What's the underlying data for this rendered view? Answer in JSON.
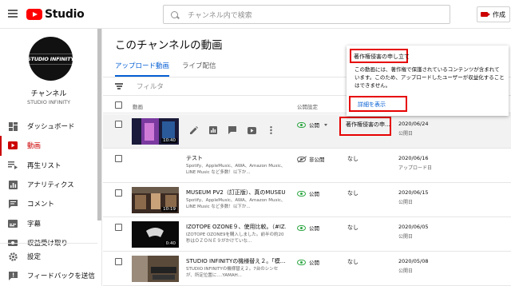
{
  "app": {
    "logo_text": "Studio"
  },
  "search": {
    "placeholder": "チャンネル内で検索"
  },
  "header": {
    "create_label": "作成"
  },
  "channel": {
    "avatar_text": "STUDIO INFINITY",
    "title": "チャンネル",
    "name": "STUDIO INFINITY"
  },
  "sidebar": {
    "items": [
      {
        "label": "ダッシュボード",
        "icon": "dashboard-icon"
      },
      {
        "label": "動画",
        "icon": "video-icon",
        "active": true
      },
      {
        "label": "再生リスト",
        "icon": "playlist-icon"
      },
      {
        "label": "アナリティクス",
        "icon": "analytics-icon"
      },
      {
        "label": "コメント",
        "icon": "comment-icon"
      },
      {
        "label": "字幕",
        "icon": "subtitles-icon"
      },
      {
        "label": "収益受け取り",
        "icon": "monetization-icon"
      }
    ],
    "bottom": [
      {
        "label": "設定",
        "icon": "gear-icon"
      },
      {
        "label": "フィードバックを送信",
        "icon": "feedback-icon"
      }
    ]
  },
  "main": {
    "title": "このチャンネルの動画",
    "tabs": [
      "アップロード動画",
      "ライブ配信"
    ],
    "filter_placeholder": "フィルタ",
    "columns": {
      "video": "動画",
      "visibility": "公開設定"
    },
    "rows": [
      {
        "title": "",
        "desc": "",
        "duration": "10:40",
        "visibility": "公開",
        "restriction": "著作権侵害の申...",
        "date": "2020/06/24",
        "date_sub": "公開日",
        "thumb": "#1a1a3a"
      },
      {
        "title": "テスト",
        "desc": "Spotify、AppleMusic、AWA、Amazon Music、LINE Music など多数！以下か...",
        "duration": "",
        "visibility": "非公開",
        "restriction": "なし",
        "date": "2020/06/16",
        "date_sub": "アップロード日",
        "thumb": ""
      },
      {
        "title": "MUSEUM PV2（訂正版）、真のMUSEUM...",
        "desc": "Spotify、AppleMusic、AWA、Amazon Music、LINE Music など多数！以下か...",
        "duration": "10:19",
        "visibility": "公開",
        "restriction": "なし",
        "date": "2020/06/15",
        "date_sub": "公開日",
        "thumb": "#3a2a22"
      },
      {
        "title": "IZOTOPE OZONE９、使用比較。（#IZ...",
        "desc": "IZOTOPE OZONE9を購入しました。前半の約20秒はＯＺＯＮＥ９がかけていな...",
        "duration": "0:40",
        "visibility": "公開",
        "restriction": "なし",
        "date": "2020/06/05",
        "date_sub": "公開日",
        "thumb": "#0a0a0a"
      },
      {
        "title": "STUDIO INFINITYの機様替え２。「模...",
        "desc": "STUDIO INFINITYの機様替え２。7台のシンセが、所定位置に....YAMAH...",
        "duration": "",
        "visibility": "公開",
        "restriction": "なし",
        "date": "2020/05/08",
        "date_sub": "公開日",
        "thumb": "#5a4a3a"
      }
    ]
  },
  "tooltip": {
    "title": "著作権侵害の申し立て",
    "body": "この動画には、著作権で保護されているコンテンツが含まれています。このため、アップロードしたユーザーが収益化することはできません。",
    "link": "詳細を表示"
  },
  "colors": {
    "accent": "#065fd4",
    "brand": "#ff0000",
    "highlight_box": "#e60000",
    "public_green": "#2ba640"
  }
}
